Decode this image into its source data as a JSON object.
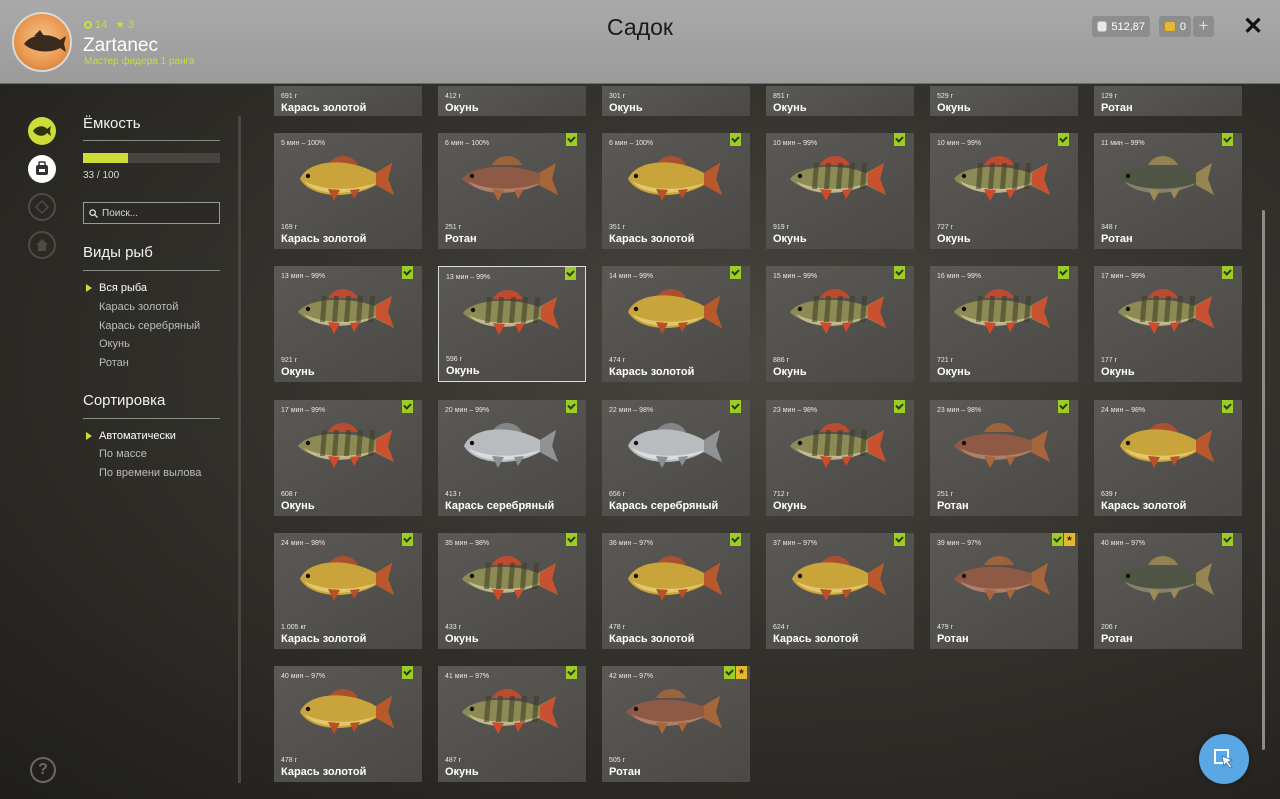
{
  "header": {
    "title": "Садок",
    "username": "Zartanec",
    "rank": "Мастер фидера 1 ранга",
    "level": "14",
    "stars": "3",
    "silver": "512,87",
    "gold": "0"
  },
  "sidebar": {
    "capacity_title": "Ёмкость",
    "capacity_text": "33 / 100",
    "capacity_fraction": 0.33,
    "search_placeholder": "Поиск...",
    "species_title": "Виды рыб",
    "species": [
      "Вся рыба",
      "Карась золотой",
      "Карась серебряный",
      "Окунь",
      "Ротан"
    ],
    "sort_title": "Сортировка",
    "sort_options": [
      "Автоматически",
      "По массе",
      "По времени вылова"
    ]
  },
  "fish_top": [
    {
      "weight": "691 г",
      "name": "Карась золотой"
    },
    {
      "weight": "412 г",
      "name": "Окунь"
    },
    {
      "weight": "301 г",
      "name": "Окунь"
    },
    {
      "weight": "851 г",
      "name": "Окунь"
    },
    {
      "weight": "529 г",
      "name": "Окунь"
    },
    {
      "weight": "129 г",
      "name": "Ротан"
    }
  ],
  "fish": [
    {
      "time": "5 мин – 100%",
      "weight": "169 г",
      "name": "Карась золотой",
      "kind": "gold",
      "tick": false
    },
    {
      "time": "6 мин – 100%",
      "weight": "251 г",
      "name": "Ротан",
      "kind": "rotan",
      "tick": true
    },
    {
      "time": "6 мин – 100%",
      "weight": "351 г",
      "name": "Карась золотой",
      "kind": "gold",
      "tick": true
    },
    {
      "time": "10 мин – 99%",
      "weight": "919 г",
      "name": "Окунь",
      "kind": "perch",
      "tick": true
    },
    {
      "time": "10 мин – 99%",
      "weight": "727 г",
      "name": "Окунь",
      "kind": "perch",
      "tick": true
    },
    {
      "time": "11 мин – 99%",
      "weight": "348 г",
      "name": "Ротан",
      "kind": "rotan-dark",
      "tick": true
    },
    {
      "time": "13 мин – 99%",
      "weight": "921 г",
      "name": "Окунь",
      "kind": "perch",
      "tick": true
    },
    {
      "time": "13 мин – 99%",
      "weight": "596 г",
      "name": "Окунь",
      "kind": "perch",
      "tick": true,
      "selected": true
    },
    {
      "time": "14 мин – 99%",
      "weight": "474 г",
      "name": "Карась золотой",
      "kind": "gold",
      "tick": true
    },
    {
      "time": "15 мин – 99%",
      "weight": "886 г",
      "name": "Окунь",
      "kind": "perch",
      "tick": true
    },
    {
      "time": "16 мин – 99%",
      "weight": "721 г",
      "name": "Окунь",
      "kind": "perch",
      "tick": true
    },
    {
      "time": "17 мин – 99%",
      "weight": "177 г",
      "name": "Окунь",
      "kind": "perch",
      "tick": true
    },
    {
      "time": "17 мин – 99%",
      "weight": "608 г",
      "name": "Окунь",
      "kind": "perch",
      "tick": true
    },
    {
      "time": "20 мин – 99%",
      "weight": "413 г",
      "name": "Карась серебряный",
      "kind": "silver",
      "tick": true
    },
    {
      "time": "22 мин – 98%",
      "weight": "656 г",
      "name": "Карась серебряный",
      "kind": "silver",
      "tick": true
    },
    {
      "time": "23 мин – 98%",
      "weight": "712 г",
      "name": "Окунь",
      "kind": "perch",
      "tick": true
    },
    {
      "time": "23 мин – 98%",
      "weight": "251 г",
      "name": "Ротан",
      "kind": "rotan",
      "tick": true
    },
    {
      "time": "24 мин – 98%",
      "weight": "639 г",
      "name": "Карась золотой",
      "kind": "gold",
      "tick": true
    },
    {
      "time": "24 мин – 98%",
      "weight": "1.005 кг",
      "name": "Карась золотой",
      "kind": "gold",
      "tick": true
    },
    {
      "time": "35 мин – 98%",
      "weight": "433 г",
      "name": "Окунь",
      "kind": "perch",
      "tick": true
    },
    {
      "time": "36 мин – 97%",
      "weight": "478 г",
      "name": "Карась золотой",
      "kind": "gold",
      "tick": true
    },
    {
      "time": "37 мин – 97%",
      "weight": "624 г",
      "name": "Карась золотой",
      "kind": "gold",
      "tick": true
    },
    {
      "time": "39 мин – 97%",
      "weight": "479 г",
      "name": "Ротан",
      "kind": "rotan",
      "tick": true,
      "star": true
    },
    {
      "time": "40 мин – 97%",
      "weight": "206 г",
      "name": "Ротан",
      "kind": "rotan-dark",
      "tick": true
    },
    {
      "time": "40 мин – 97%",
      "weight": "478 г",
      "name": "Карась золотой",
      "kind": "gold",
      "tick": true
    },
    {
      "time": "41 мин – 97%",
      "weight": "487 г",
      "name": "Окунь",
      "kind": "perch",
      "tick": true
    },
    {
      "time": "42 мин – 97%",
      "weight": "505 г",
      "name": "Ротан",
      "kind": "rotan",
      "tick": true,
      "star": true
    }
  ],
  "colors": {
    "accent": "#cddc39",
    "tick": "#9ccc2a",
    "star": "#e5b82d",
    "action_button": "#5aa7e6"
  },
  "icons": {
    "help": "?",
    "close": "✕",
    "plus": "+",
    "star": "★"
  }
}
